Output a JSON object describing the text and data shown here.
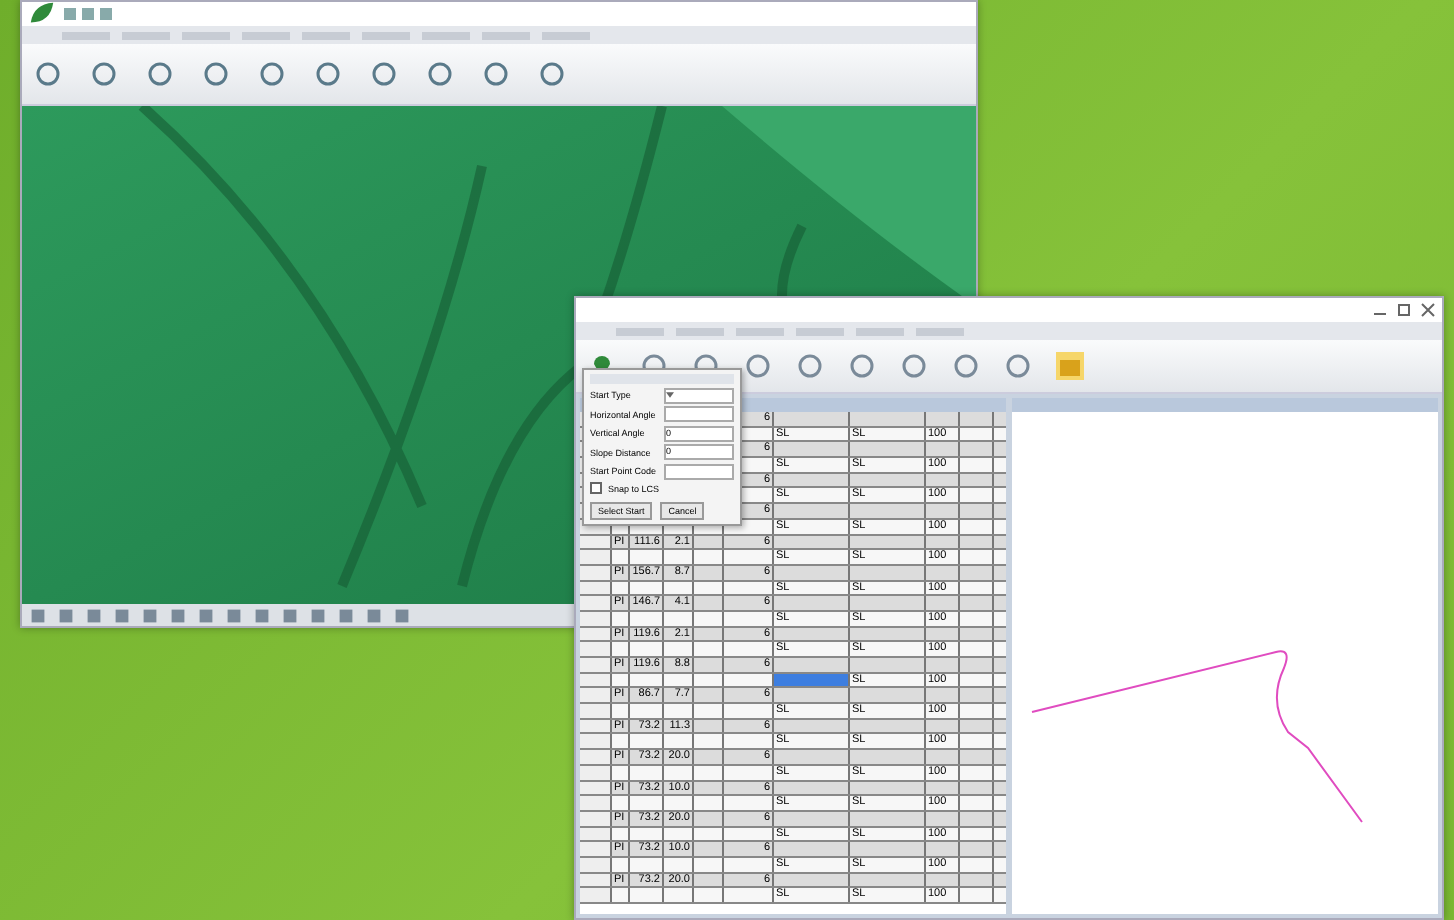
{
  "dialog": {
    "fields": [
      {
        "label": "Start Type",
        "kind": "select"
      },
      {
        "label": "Horizontal Angle",
        "kind": "text"
      },
      {
        "label": "Vertical Angle",
        "kind": "text",
        "value": "0"
      },
      {
        "label": "Slope Distance",
        "kind": "text",
        "value": "0"
      },
      {
        "label": "Start Point Code",
        "kind": "text"
      }
    ],
    "checkbox": {
      "label": "Snap to LCS",
      "checked": false
    },
    "buttons": [
      "Select Start",
      "Cancel"
    ]
  },
  "table": {
    "rows": [
      {
        "kind": "pi",
        "flag": "6"
      },
      {
        "kind": "station",
        "c1": "SL",
        "c2": "SL",
        "c3": "100",
        "selected": false
      },
      {
        "kind": "pi",
        "flag": "6"
      },
      {
        "kind": "station",
        "c1": "SL",
        "c2": "SL",
        "c3": "100",
        "selected": false
      },
      {
        "kind": "pi",
        "flag": "6"
      },
      {
        "kind": "station",
        "c1": "SL",
        "c2": "SL",
        "c3": "100",
        "selected": false
      },
      {
        "kind": "pi",
        "flag": "6"
      },
      {
        "kind": "station",
        "c1": "SL",
        "c2": "SL",
        "c3": "100",
        "selected": false
      },
      {
        "kind": "pi",
        "type": "PI",
        "dist": "111.6",
        "v1": "2.1",
        "flag": "6"
      },
      {
        "kind": "station",
        "c1": "SL",
        "c2": "SL",
        "c3": "100",
        "selected": false
      },
      {
        "kind": "pi",
        "type": "PI",
        "dist": "156.7",
        "v1": "8.7",
        "flag": "6"
      },
      {
        "kind": "station",
        "c1": "SL",
        "c2": "SL",
        "c3": "100",
        "selected": false
      },
      {
        "kind": "pi",
        "type": "PI",
        "dist": "146.7",
        "v1": "4.1",
        "flag": "6"
      },
      {
        "kind": "station",
        "c1": "SL",
        "c2": "SL",
        "c3": "100",
        "selected": false
      },
      {
        "kind": "pi",
        "type": "PI",
        "dist": "119.6",
        "v1": "2.1",
        "flag": "6"
      },
      {
        "kind": "station",
        "c1": "SL",
        "c2": "SL",
        "c3": "100",
        "selected": false
      },
      {
        "kind": "pi",
        "type": "PI",
        "dist": "119.6",
        "v1": "8.8",
        "flag": "6"
      },
      {
        "kind": "station",
        "c1": "",
        "c2": "SL",
        "c3": "100",
        "selected": true
      },
      {
        "kind": "pi",
        "type": "PI",
        "dist": "86.7",
        "v1": "7.7",
        "flag": "6"
      },
      {
        "kind": "station",
        "c1": "SL",
        "c2": "SL",
        "c3": "100",
        "selected": false
      },
      {
        "kind": "pi",
        "type": "PI",
        "dist": "73.2",
        "v1": "11.3",
        "flag": "6"
      },
      {
        "kind": "station",
        "c1": "SL",
        "c2": "SL",
        "c3": "100",
        "selected": false
      },
      {
        "kind": "pi",
        "type": "PI",
        "dist": "73.2",
        "v1": "20.0",
        "flag": "6"
      },
      {
        "kind": "station",
        "c1": "SL",
        "c2": "SL",
        "c3": "100",
        "selected": false
      },
      {
        "kind": "pi",
        "type": "PI",
        "dist": "73.2",
        "v1": "10.0",
        "flag": "6"
      },
      {
        "kind": "station",
        "c1": "SL",
        "c2": "SL",
        "c3": "100",
        "selected": false
      },
      {
        "kind": "pi",
        "type": "PI",
        "dist": "73.2",
        "v1": "20.0",
        "flag": "6"
      },
      {
        "kind": "station",
        "c1": "SL",
        "c2": "SL",
        "c3": "100",
        "selected": false
      },
      {
        "kind": "pi",
        "type": "PI",
        "dist": "73.2",
        "v1": "10.0",
        "flag": "6"
      },
      {
        "kind": "station",
        "c1": "SL",
        "c2": "SL",
        "c3": "100",
        "selected": false
      },
      {
        "kind": "pi",
        "type": "PI",
        "dist": "73.2",
        "v1": "20.0",
        "flag": "6"
      },
      {
        "kind": "station",
        "c1": "SL",
        "c2": "SL",
        "c3": "100",
        "selected": false
      }
    ]
  }
}
